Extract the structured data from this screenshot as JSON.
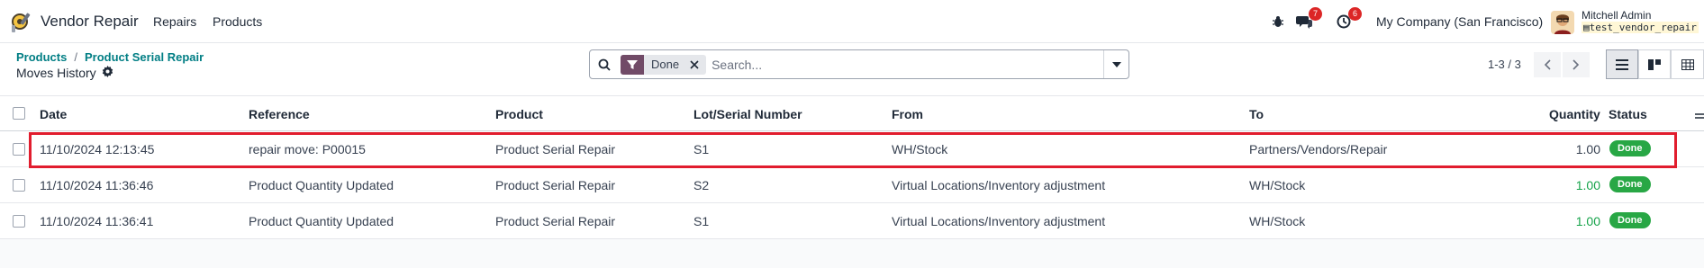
{
  "navbar": {
    "app_name": "Vendor Repair",
    "menu": [
      "Repairs",
      "Products"
    ],
    "activity_count": "7",
    "clock_count": "6",
    "company": "My Company (San Francisco)",
    "user_name": "Mitchell Admin",
    "database": "test_vendor_repair"
  },
  "control": {
    "breadcrumb": [
      "Products",
      "Product Serial Repair"
    ],
    "separator": "/",
    "title": "Moves History",
    "facet_value": "Done",
    "search_placeholder": "Search...",
    "pager": "1-3 / 3"
  },
  "table": {
    "headers": {
      "date": "Date",
      "reference": "Reference",
      "product": "Product",
      "lot": "Lot/Serial Number",
      "from": "From",
      "to": "To",
      "quantity": "Quantity",
      "status": "Status"
    },
    "rows": [
      {
        "date": "11/10/2024 12:13:45",
        "reference": "repair move: P00015",
        "product": "Product Serial Repair",
        "lot": "S1",
        "from": "WH/Stock",
        "to": "Partners/Vendors/Repair",
        "quantity": "1.00",
        "status": "Done"
      },
      {
        "date": "11/10/2024 11:36:46",
        "reference": "Product Quantity Updated",
        "product": "Product Serial Repair",
        "lot": "S2",
        "from": "Virtual Locations/Inventory adjustment",
        "to": "WH/Stock",
        "quantity": "1.00",
        "status": "Done"
      },
      {
        "date": "11/10/2024 11:36:41",
        "reference": "Product Quantity Updated",
        "product": "Product Serial Repair",
        "lot": "S1",
        "from": "Virtual Locations/Inventory adjustment",
        "to": "WH/Stock",
        "quantity": "1.00",
        "status": "Done"
      }
    ]
  },
  "colors": {
    "brand": "#714b67",
    "link": "#017e84",
    "status_done": "#28a745",
    "highlight": "#e11d2e"
  },
  "icons": [
    "app-logo-icon",
    "bug-icon",
    "chat-icon",
    "clock-icon",
    "gear-icon",
    "search-icon",
    "filter-icon",
    "close-icon",
    "caret-down-icon",
    "chevron-left-icon",
    "chevron-right-icon",
    "list-view-icon",
    "kanban-view-icon",
    "pivot-view-icon",
    "column-settings-icon"
  ]
}
